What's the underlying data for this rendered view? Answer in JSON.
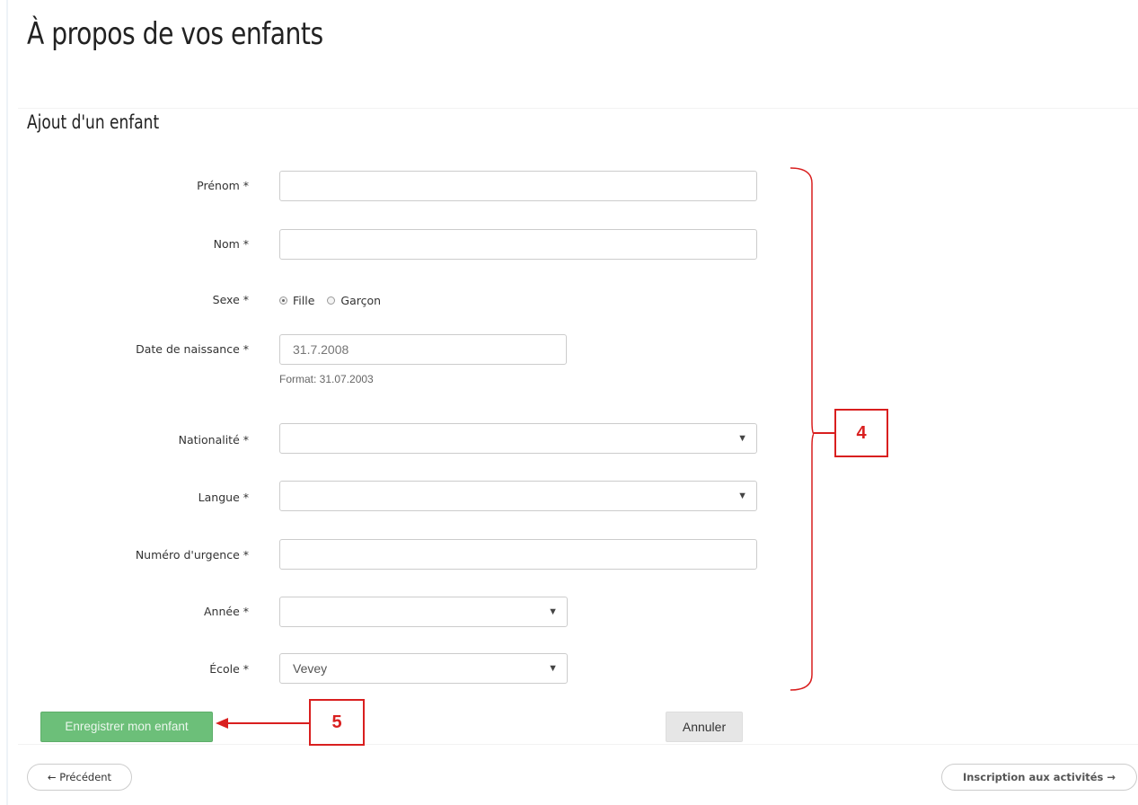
{
  "page": {
    "title": "À propos de vos enfants",
    "section_title": "Ajout d'un enfant"
  },
  "form": {
    "prenom_label": "Prénom *",
    "prenom_value": "",
    "nom_label": "Nom *",
    "nom_value": "",
    "sexe_label": "Sexe *",
    "sexe_options": [
      "Fille",
      "Garçon"
    ],
    "sexe_selected": "Fille",
    "dob_label": "Date de naissance *",
    "dob_placeholder": "31.7.2008",
    "dob_hint": "Format: 31.07.2003",
    "nationalite_label": "Nationalité *",
    "nationalite_value": "",
    "langue_label": "Langue *",
    "langue_value": "",
    "urgence_label": "Numéro d'urgence *",
    "urgence_value": "",
    "annee_label": "Année *",
    "annee_value": "",
    "ecole_label": "École *",
    "ecole_value": "Vevey",
    "caret_icon": "▼"
  },
  "actions": {
    "save_label": "Enregistrer mon enfant",
    "cancel_label": "Annuler"
  },
  "nav": {
    "prev_label": "← Précédent",
    "next_label": "Inscription aux activités →"
  },
  "annotations": {
    "callout_4": "4",
    "callout_5": "5",
    "color": "#d91f1f"
  }
}
